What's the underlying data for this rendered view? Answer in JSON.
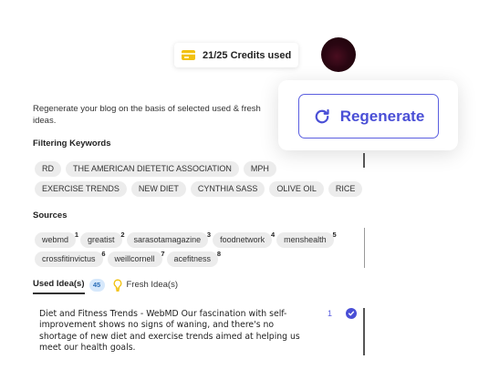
{
  "header": {
    "credits_text": "21/25 Credits used",
    "credits_icon": "credit-card-icon",
    "avatar_icon": "user-avatar"
  },
  "regenerate": {
    "label": "Regenerate",
    "icon": "refresh-icon",
    "accent_color": "#4a4fd6"
  },
  "description": "Regenerate your blog on the basis of selected used & fresh ideas.",
  "filtering": {
    "title": "Filtering Keywords",
    "keywords": [
      "RD",
      "THE AMERICAN DIETETIC ASSOCIATION",
      "MPH",
      "EXERCISE TRENDS",
      "NEW DIET",
      "CYNTHIA SASS",
      "OLIVE OIL",
      "RICE"
    ]
  },
  "sources": {
    "title": "Sources",
    "items": [
      {
        "name": "webmd",
        "num": "1"
      },
      {
        "name": "greatist",
        "num": "2"
      },
      {
        "name": "sarasotamagazine",
        "num": "3"
      },
      {
        "name": "foodnetwork",
        "num": "4"
      },
      {
        "name": "menshealth",
        "num": "5"
      },
      {
        "name": "crossfitinvictus",
        "num": "6"
      },
      {
        "name": "weillcornell",
        "num": "7"
      },
      {
        "name": "acefitness",
        "num": "8"
      }
    ]
  },
  "ideas": {
    "used_tab": "Used Idea(s)",
    "used_count": "45",
    "fresh_tab": "Fresh Idea(s)",
    "fresh_icon": "lightbulb-icon",
    "items": [
      {
        "text": "Diet and Fitness Trends - WebMD Our fascination with self-improvement shows no signs of waning, and there's no shortage of new diet and exercise trends aimed at helping us meet our health goals.",
        "num": "1",
        "selected": true
      }
    ]
  }
}
